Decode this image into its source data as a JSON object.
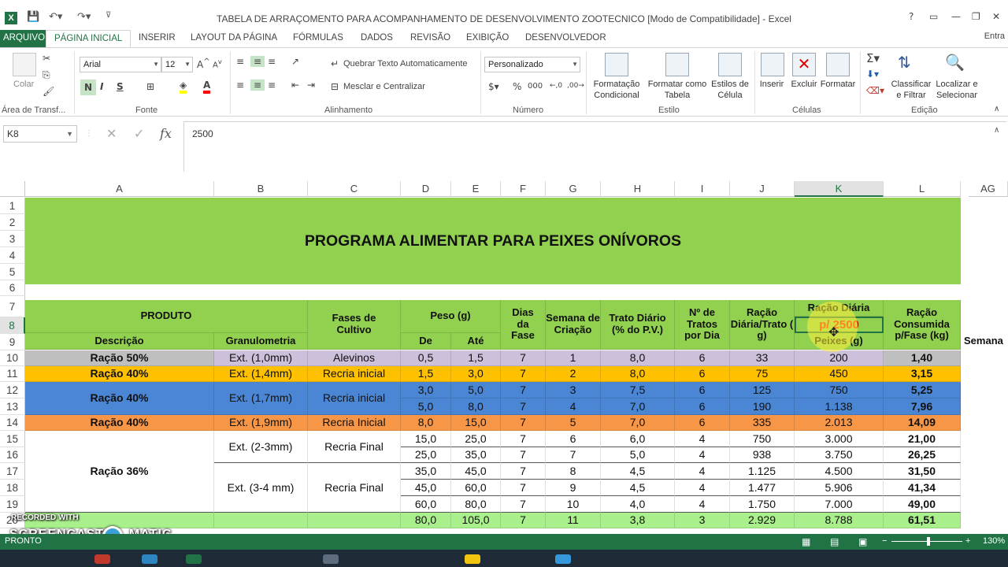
{
  "window": {
    "title": "TABELA DE ARRAÇOMENTO PARA ACOMPANHAMENTO DE DESENVOLVIMENTO ZOOTECNICO  [Modo de Compatibilidade] - Excel",
    "help": "?",
    "minimize": "—",
    "maximize": "❐",
    "close": "✕"
  },
  "tabs": [
    "ARQUIVO",
    "PÁGINA INICIAL",
    "INSERIR",
    "LAYOUT DA PÁGINA",
    "FÓRMULAS",
    "DADOS",
    "REVISÃO",
    "EXIBIÇÃO",
    "DESENVOLVEDOR"
  ],
  "signin": "Entra",
  "ribbon": {
    "clipboard": {
      "paste": "Colar",
      "label": "Área de Transf..."
    },
    "font": {
      "name": "Arial",
      "size": "12",
      "bold": "N",
      "italic": "I",
      "underline": "S",
      "label": "Fonte"
    },
    "alignment": {
      "wrap": "Quebrar Texto Automaticamente",
      "merge": "Mesclar e Centralizar",
      "label": "Alinhamento"
    },
    "number": {
      "format": "Personalizado",
      "percent": "%",
      "thousands": "000",
      "label": "Número"
    },
    "styles": {
      "conditional": "Formatação Condicional",
      "table": "Formatar como Tabela",
      "cell": "Estilos de Célula",
      "label": "Estilo"
    },
    "cells": {
      "insert": "Inserir",
      "delete": "Excluir",
      "format": "Formatar",
      "label": "Células"
    },
    "editing": {
      "sort": "Classificar e Filtrar",
      "find": "Localizar e Selecionar",
      "label": "Edição"
    }
  },
  "formula_bar": {
    "name_box": "K8",
    "formula": "2500"
  },
  "columns": [
    "A",
    "B",
    "C",
    "D",
    "E",
    "F",
    "G",
    "H",
    "I",
    "J",
    "K",
    "L",
    "AG"
  ],
  "rows": [
    "1",
    "2",
    "3",
    "4",
    "5",
    "6",
    "7",
    "8",
    "9",
    "10",
    "11",
    "12",
    "13",
    "14",
    "15",
    "16",
    "17",
    "18",
    "19",
    "20"
  ],
  "sheet": {
    "title": "PROGRAMA ALIMENTAR PARA PEIXES ONÍVOROS",
    "produto": "PRODUTO",
    "descricao": "Descrição",
    "granulometria": "Granulometria",
    "fases": "Fases de Cultivo",
    "peso": "Peso (g)",
    "de": "De",
    "ate": "Até",
    "dias": "Dias da Fase",
    "semana": "Semana de Criação",
    "trato": "Trato Diário (% do P.V.)",
    "ntratos": "Nº de Tratos por Dia",
    "racao_trato": "Ração Diária/Trato ( g)",
    "racao_diaria_top": "Ração Diária",
    "k8_value": "p/ 2500",
    "racao_diaria_bottom": "Peixes (g)",
    "consumida": "Ração Consumida p/Fase (kg)",
    "semana_side": "Semana",
    "r10": {
      "a": "Ração 50%",
      "b": "Ext. (1,0mm)",
      "c": "Alevinos",
      "d": "0,5",
      "e": "1,5",
      "f": "7",
      "g": "1",
      "h": "8,0",
      "i": "6",
      "j": "33",
      "k": "200",
      "l": "1,40"
    },
    "r11": {
      "a": "Ração 40%",
      "b": "Ext. (1,4mm)",
      "c": "Recria inicial",
      "d": "1,5",
      "e": "3,0",
      "f": "7",
      "g": "2",
      "h": "8,0",
      "i": "6",
      "j": "75",
      "k": "450",
      "l": "3,15"
    },
    "r12": {
      "a": "Ração 40%",
      "b": "Ext. (1,7mm)",
      "c": "Recria inicial",
      "d": "3,0",
      "e": "5,0",
      "f": "7",
      "g": "3",
      "h": "7,5",
      "i": "6",
      "j": "125",
      "k": "750",
      "l": "5,25"
    },
    "r13": {
      "d": "5,0",
      "e": "8,0",
      "f": "7",
      "g": "4",
      "h": "7,0",
      "i": "6",
      "j": "190",
      "k": "1.138",
      "l": "7,96"
    },
    "r14": {
      "a": "Ração 40%",
      "b": "Ext. (1,9mm)",
      "c": "Recria Inicial",
      "d": "8,0",
      "e": "15,0",
      "f": "7",
      "g": "5",
      "h": "7,0",
      "i": "6",
      "j": "335",
      "k": "2.013",
      "l": "14,09"
    },
    "r15": {
      "a": "Ração 36%",
      "b": "Ext. (2-3mm)",
      "c": "Recria Final",
      "d": "15,0",
      "e": "25,0",
      "f": "7",
      "g": "6",
      "h": "6,0",
      "i": "4",
      "j": "750",
      "k": "3.000",
      "l": "21,00"
    },
    "r16": {
      "d": "25,0",
      "e": "35,0",
      "f": "7",
      "g": "7",
      "h": "5,0",
      "i": "4",
      "j": "938",
      "k": "3.750",
      "l": "26,25"
    },
    "r17": {
      "b": "Ext. (3-4 mm)",
      "c": "Recria Final",
      "d": "35,0",
      "e": "45,0",
      "f": "7",
      "g": "8",
      "h": "4,5",
      "i": "4",
      "j": "1.125",
      "k": "4.500",
      "l": "31,50"
    },
    "r18": {
      "d": "45,0",
      "e": "60,0",
      "f": "7",
      "g": "9",
      "h": "4,5",
      "i": "4",
      "j": "1.477",
      "k": "5.906",
      "l": "41,34"
    },
    "r19": {
      "d": "60,0",
      "e": "80,0",
      "f": "7",
      "g": "10",
      "h": "4,0",
      "i": "4",
      "j": "1.750",
      "k": "7.000",
      "l": "49,00"
    },
    "r20": {
      "d": "80,0",
      "e": "105,0",
      "f": "7",
      "g": "11",
      "h": "3,8",
      "i": "3",
      "j": "2.929",
      "k": "8.788",
      "l": "61,51"
    }
  },
  "watermark": {
    "line1": "RECORDED WITH",
    "line2": "SCREENCAST",
    "line3": "MATIC"
  },
  "status": {
    "ready": "PRONTO",
    "zoom": "130%"
  },
  "colors": {
    "excel_green": "#217346",
    "lime": "#92d050",
    "gray": "#bfbfbf",
    "orange": "#ffc000",
    "blue": "#4a86d4",
    "salmon": "#f79646",
    "light_green": "#a9f08c",
    "lavender": "#ccc0da",
    "red_text": "#ff0000"
  }
}
